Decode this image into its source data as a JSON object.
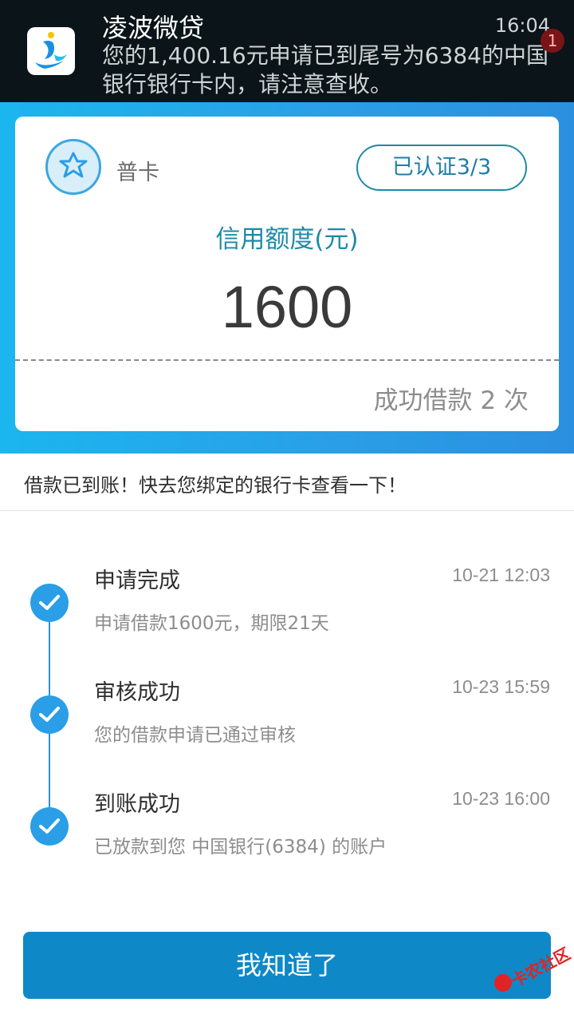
{
  "notification": {
    "app_name": "凌波微贷",
    "time": "16:04",
    "message": "您的1,400.16元申请已到尾号为6384的中国银行银行卡内，请注意查收。",
    "badge_count": "1"
  },
  "card": {
    "level": "普卡",
    "verify_label": "已认证3/3",
    "limit_label": "信用额度(元)",
    "limit_value": "1600",
    "loan_count": "成功借款 2 次"
  },
  "message": "借款已到账！快去您绑定的银行卡查看一下！",
  "steps": [
    {
      "title": "申请完成",
      "time": "10-21 12:03",
      "desc": "申请借款1600元，期限21天"
    },
    {
      "title": "审核成功",
      "time": "10-23 15:59",
      "desc": "您的借款申请已通过审核"
    },
    {
      "title": "到账成功",
      "time": "10-23 16:00",
      "desc": "已放款到您 中国银行(6384) 的账户"
    }
  ],
  "button_label": "我知道了",
  "watermark": "卡农社区",
  "colors": {
    "accent": "#2a9ee6",
    "button": "#0f88c8",
    "teal_text": "#1d8aa8"
  }
}
